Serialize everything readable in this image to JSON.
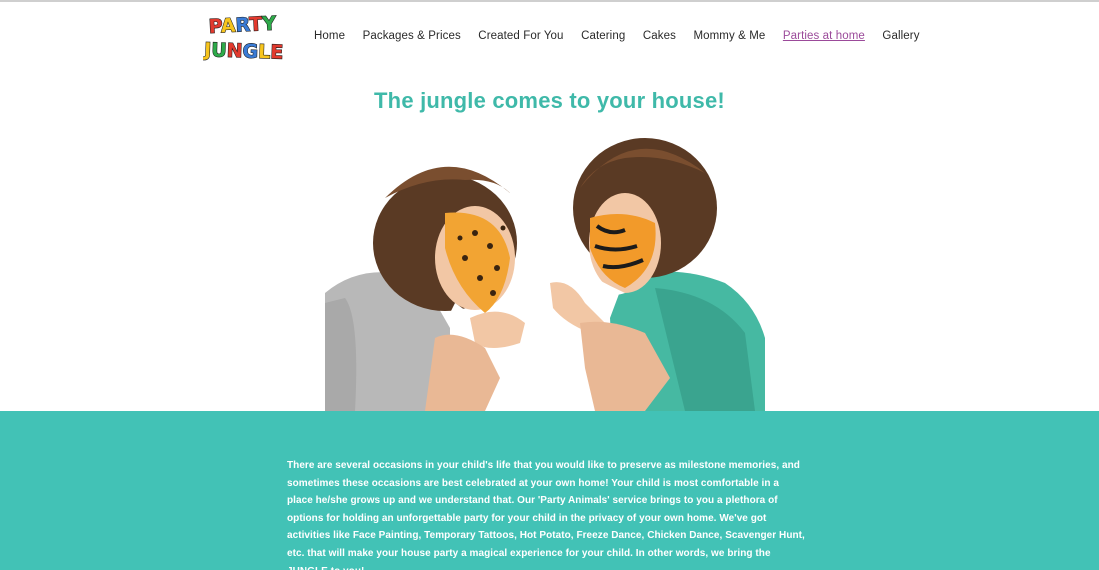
{
  "brand": {
    "logo_line1": "PARTY",
    "logo_line2": "JUNGLE"
  },
  "nav": {
    "items": [
      {
        "label": "Home",
        "active": false
      },
      {
        "label": "Packages & Prices",
        "active": false
      },
      {
        "label": "Created For You",
        "active": false
      },
      {
        "label": "Catering",
        "active": false
      },
      {
        "label": "Cakes",
        "active": false
      },
      {
        "label": "Mommy & Me",
        "active": false
      },
      {
        "label": "Parties at home",
        "active": true
      },
      {
        "label": "Gallery",
        "active": false
      }
    ]
  },
  "hero": {
    "title": "The jungle comes to your house!"
  },
  "intro": {
    "text": "There are several occasions in your child's life that you would like to preserve as milestone memories, and sometimes these occasions are best celebrated at your own home! Your child is most comfortable in a place he/she grows up and we understand that. Our 'Party Animals' service brings to you a plethora of options for holding an unforgettable party for your child in the privacy of your own home. We've got activities like Face Painting, Temporary Tattoos, Hot Potato, Freeze Dance, Chicken Dance, Scavenger Hunt, etc. that will make your house party a magical experience for your child. In other words, we bring the JUNGLE to you!"
  },
  "colors": {
    "accent": "#3fb9a9",
    "band": "#42c2b6",
    "active_link": "#9b4a9a"
  }
}
